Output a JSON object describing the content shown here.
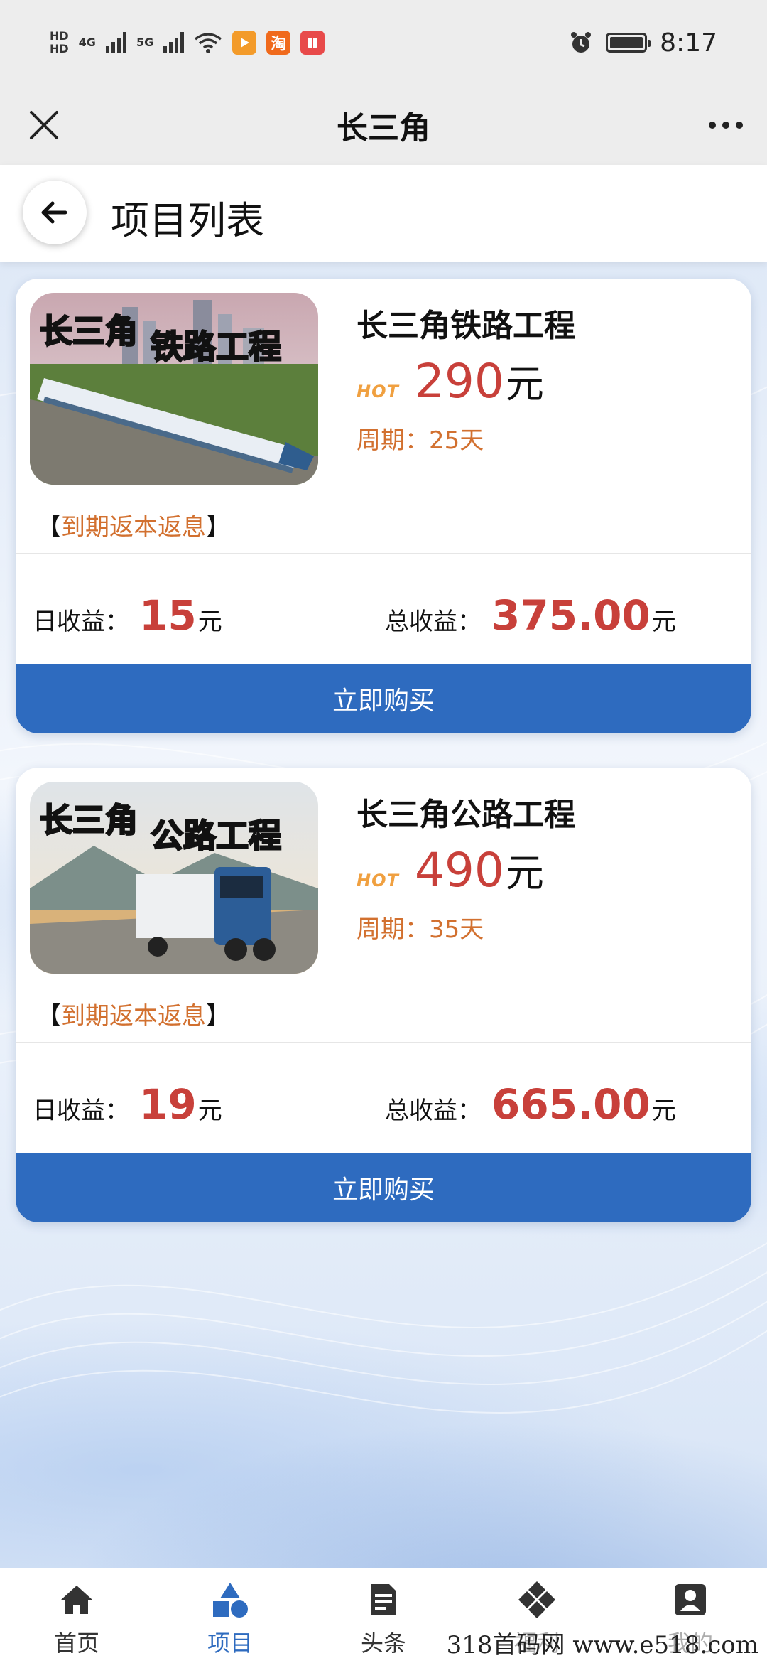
{
  "status_bar": {
    "hd1": "HD",
    "hd2": "HD",
    "net1": "4G",
    "net2": "5G",
    "taobao": "淘",
    "time": "8:17"
  },
  "title_bar": {
    "title": "长三角"
  },
  "page_header": {
    "title": "项目列表"
  },
  "projects": [
    {
      "name": "长三角铁路工程",
      "thumb_title_left": "长三角",
      "thumb_title_right": "铁路工程",
      "hot": "HOT",
      "price": "290",
      "price_unit": "元",
      "period_label": "周期：",
      "period_value": "25天",
      "refund_note": "到期返本返息",
      "bracket_left": "【",
      "bracket_right": "】",
      "daily_label": "日收益：",
      "daily_value": "15",
      "daily_unit": "元",
      "total_label": "总收益：",
      "total_value": "375.00",
      "total_unit": "元",
      "buy_label": "立即购买"
    },
    {
      "name": "长三角公路工程",
      "thumb_title_left": "长三角",
      "thumb_title_right": "公路工程",
      "hot": "HOT",
      "price": "490",
      "price_unit": "元",
      "period_label": "周期：",
      "period_value": "35天",
      "refund_note": "到期返本返息",
      "bracket_left": "【",
      "bracket_right": "】",
      "daily_label": "日收益：",
      "daily_value": "19",
      "daily_unit": "元",
      "total_label": "总收益：",
      "total_value": "665.00",
      "total_unit": "元",
      "buy_label": "立即购买"
    }
  ],
  "tab_bar": {
    "tabs": [
      {
        "label": "首页",
        "icon": "home-icon"
      },
      {
        "label": "项目",
        "icon": "shapes-icon",
        "active": true
      },
      {
        "label": "头条",
        "icon": "document-icon"
      },
      {
        "label": "福利",
        "icon": "diamond-icon"
      },
      {
        "label": "我的",
        "icon": "user-icon"
      }
    ]
  },
  "watermark": "318首码网 www.e518.com",
  "colors": {
    "accent": "#2e6bbf",
    "price": "#c8403a",
    "orange": "#d2702f"
  }
}
